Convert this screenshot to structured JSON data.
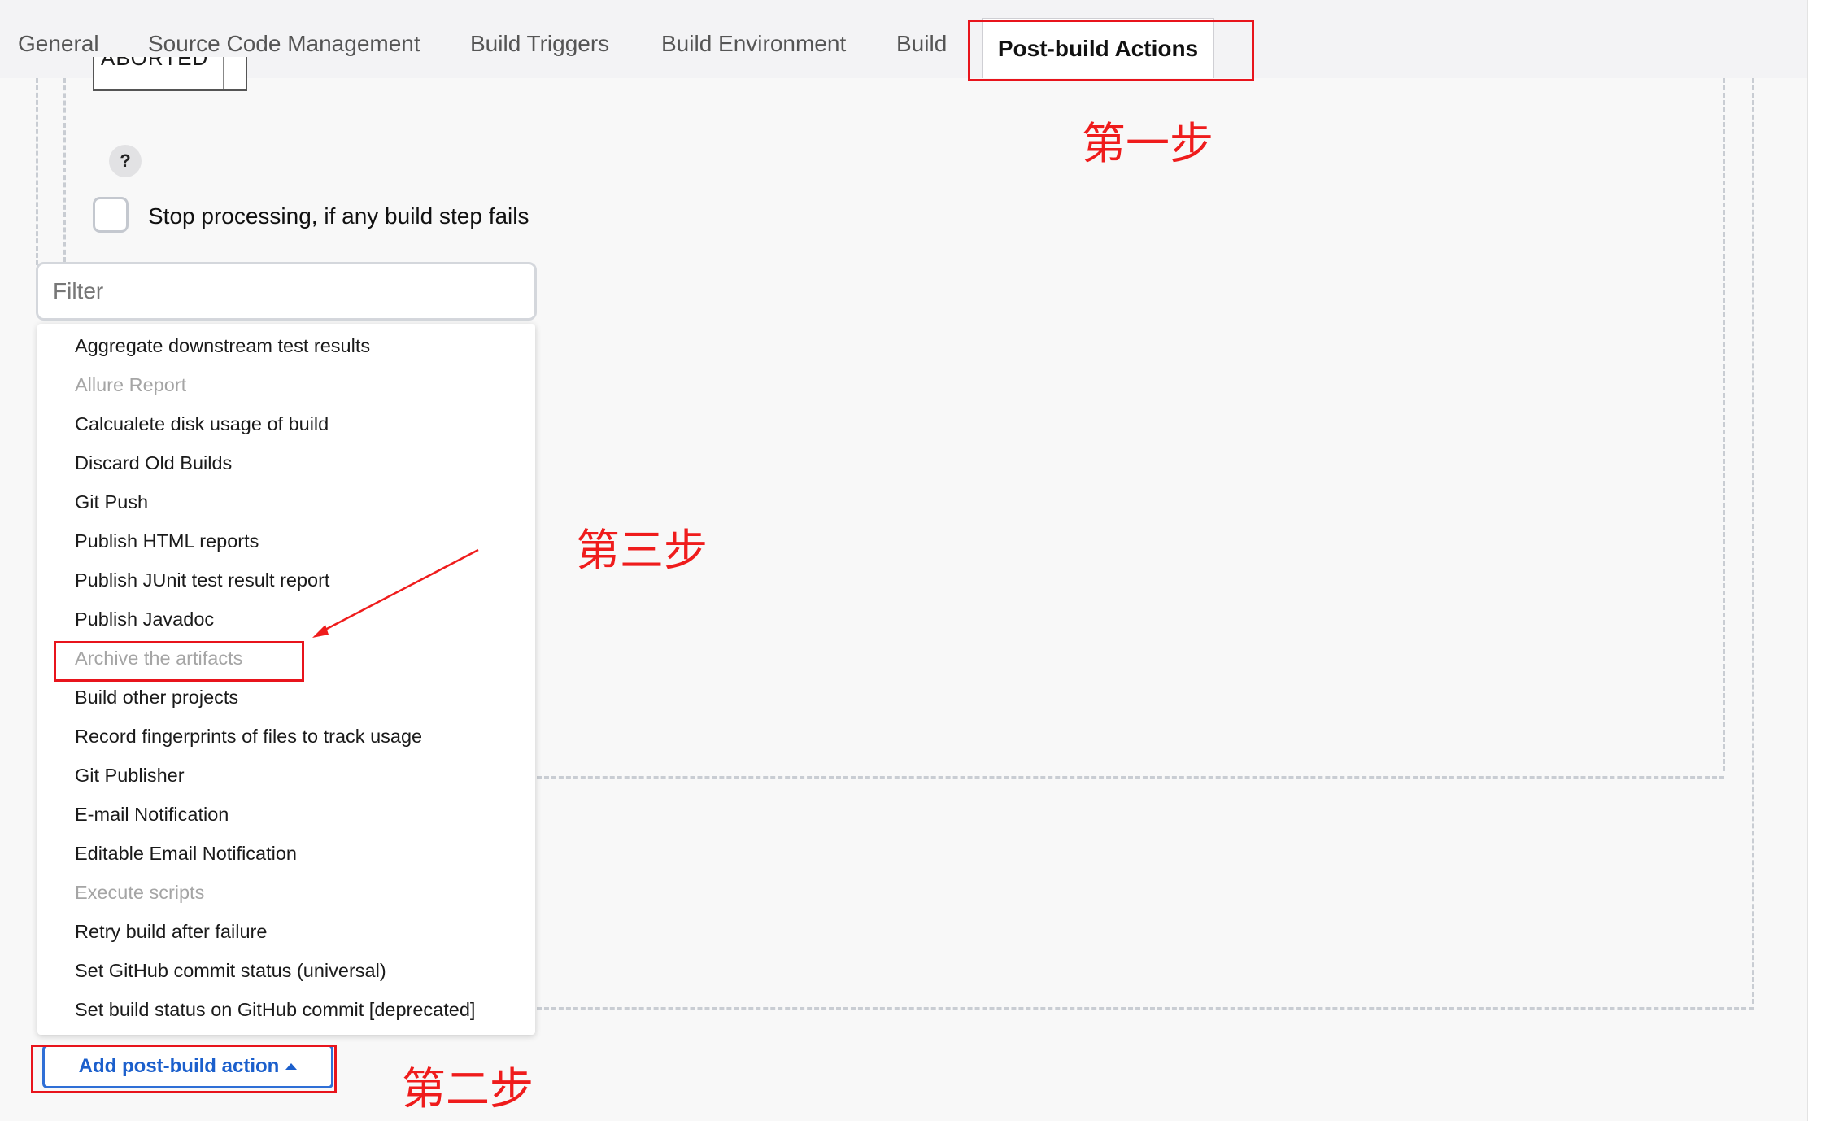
{
  "tabs": [
    {
      "label": "General"
    },
    {
      "label": "Source Code Management"
    },
    {
      "label": "Build Triggers"
    },
    {
      "label": "Build Environment"
    },
    {
      "label": "Build"
    },
    {
      "label": "Post-build Actions",
      "active": true
    }
  ],
  "form": {
    "partial_select_value": "ABORTED",
    "help_glyph": "?",
    "stop_processing_label": "Stop processing, if any build step fails",
    "stop_processing_checked": false
  },
  "dropdown": {
    "filter_placeholder": "Filter",
    "items": [
      {
        "label": "Aggregate downstream test results",
        "disabled": false
      },
      {
        "label": "Allure Report",
        "disabled": true
      },
      {
        "label": "Calcualete disk usage of build",
        "disabled": false
      },
      {
        "label": "Discard Old Builds",
        "disabled": false
      },
      {
        "label": "Git Push",
        "disabled": false
      },
      {
        "label": "Publish HTML reports",
        "disabled": false
      },
      {
        "label": "Publish JUnit test result report",
        "disabled": false
      },
      {
        "label": "Publish Javadoc",
        "disabled": false
      },
      {
        "label": "Archive the artifacts",
        "disabled": true
      },
      {
        "label": "Build other projects",
        "disabled": false
      },
      {
        "label": "Record fingerprints of files to track usage",
        "disabled": false
      },
      {
        "label": "Git Publisher",
        "disabled": false
      },
      {
        "label": "E-mail Notification",
        "disabled": false
      },
      {
        "label": "Editable Email Notification",
        "disabled": false
      },
      {
        "label": "Execute scripts",
        "disabled": true
      },
      {
        "label": "Retry build after failure",
        "disabled": false
      },
      {
        "label": "Set GitHub commit status (universal)",
        "disabled": false
      },
      {
        "label": "Set build status on GitHub commit [deprecated]",
        "disabled": false
      }
    ]
  },
  "add_button": {
    "label": "Add post-build action",
    "icon": "caret-up-icon"
  },
  "annotations": {
    "step1": "第一步",
    "step2": "第二步",
    "step3": "第三步",
    "color": "#e8141c"
  }
}
